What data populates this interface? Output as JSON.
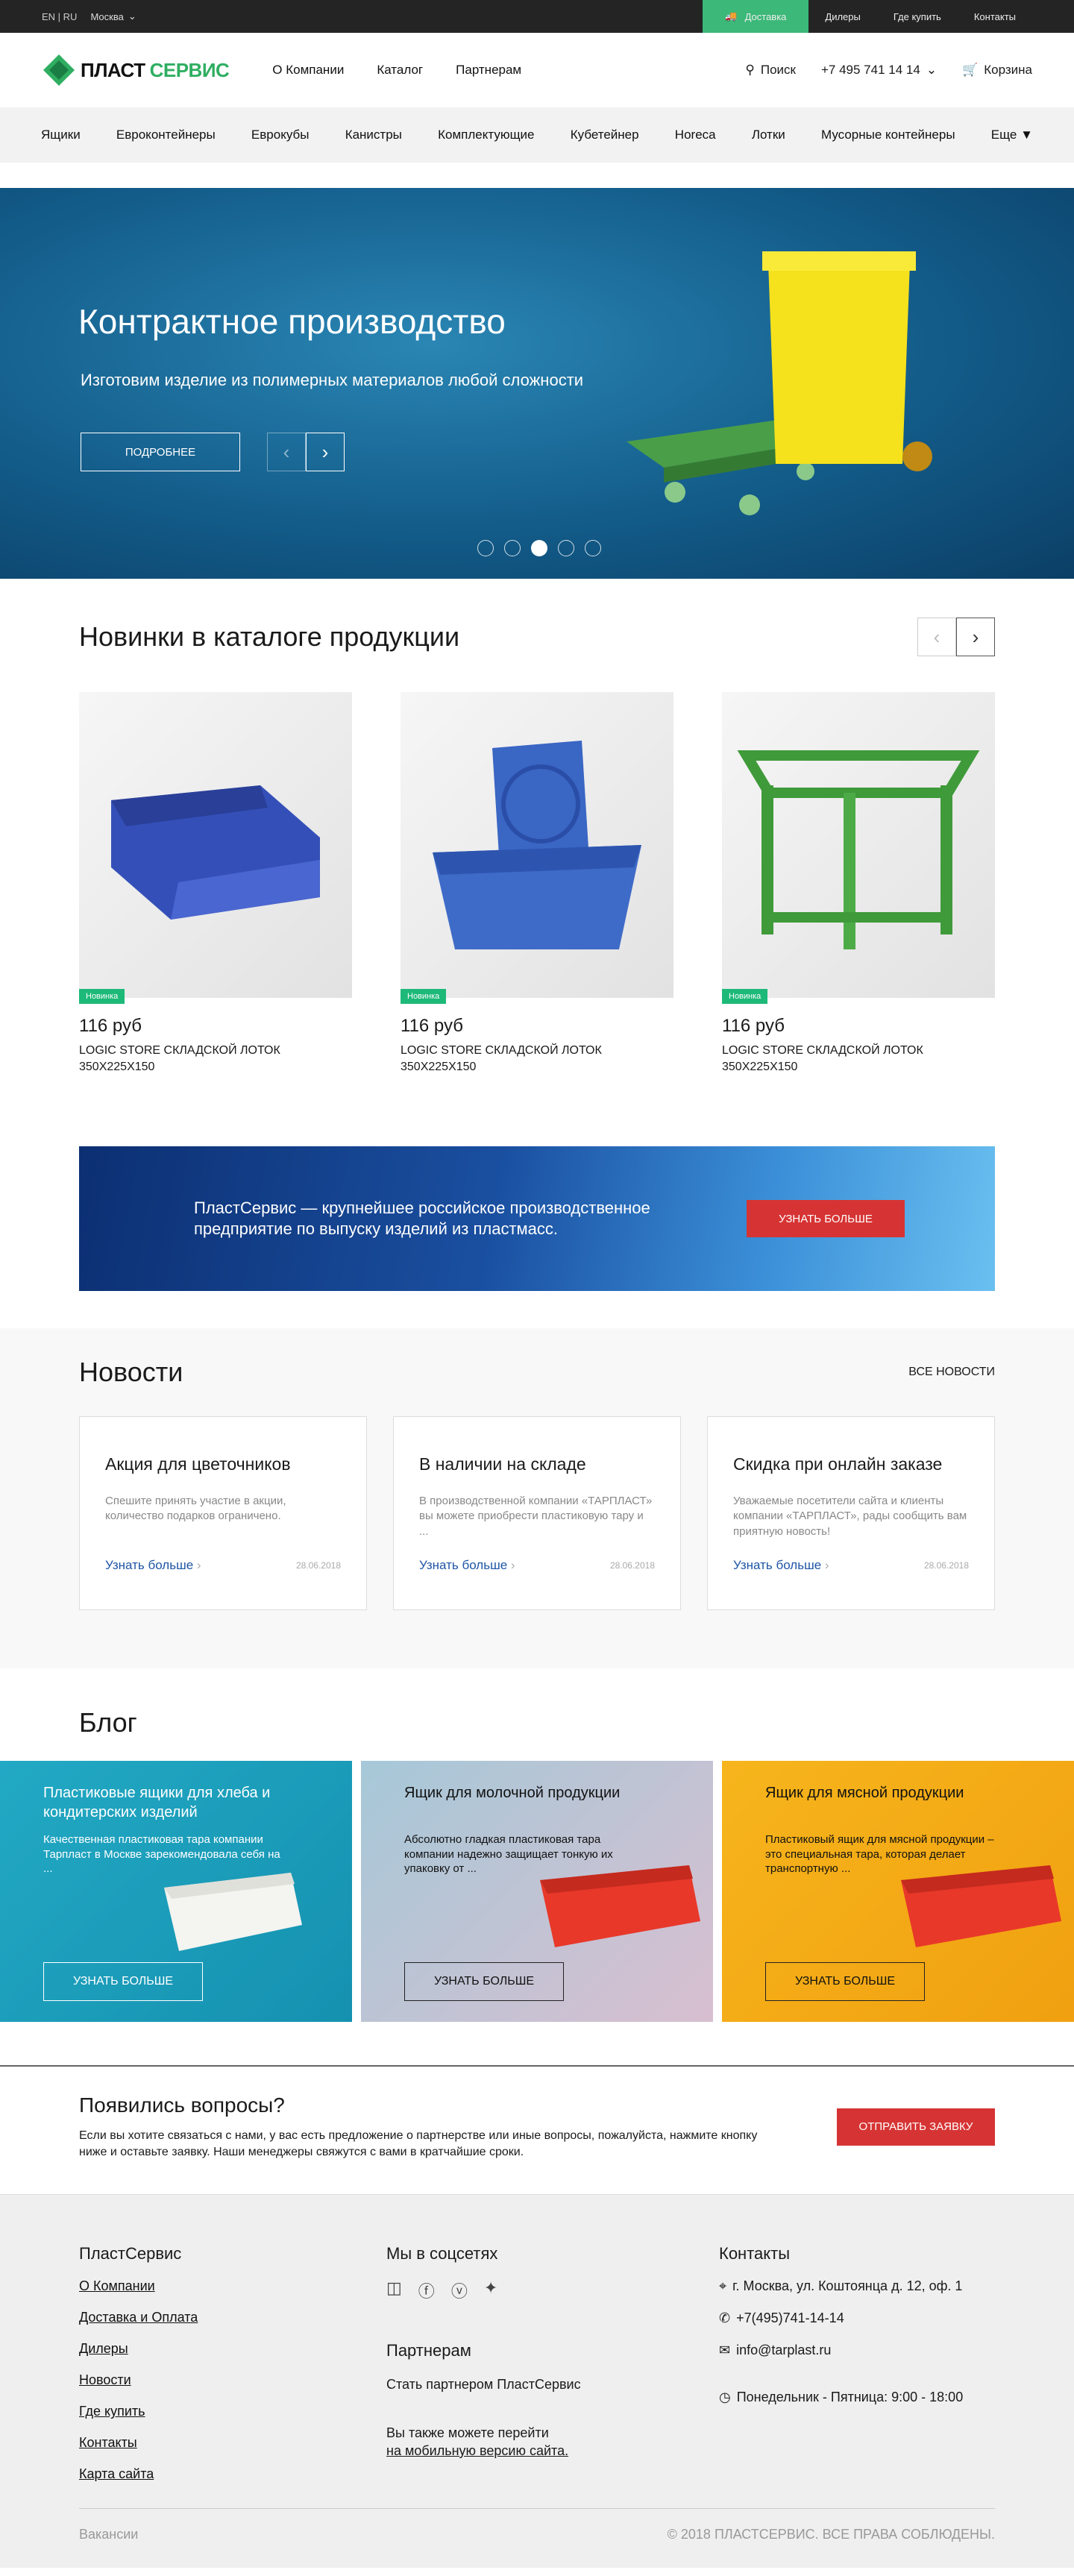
{
  "topbar": {
    "lang": "EN | RU",
    "city": "Москва",
    "delivery": "Доставка",
    "dealers": "Дилеры",
    "where_buy": "Где купить",
    "contacts": "Контакты"
  },
  "header": {
    "logo1": "ПЛАСТ",
    "logo2": "СЕРВИС",
    "nav": [
      "О Компании",
      "Каталог",
      "Партнерам"
    ],
    "search": "Поиск",
    "phone": "+7 495 741 14 14",
    "cart": "Корзина"
  },
  "catbar": [
    "Ящики",
    "Евроконтейнеры",
    "Еврокубы",
    "Канистры",
    "Комплектующие",
    "Кубетейнер",
    "Horeca",
    "Лотки",
    "Мусорные контейнеры",
    "Еще"
  ],
  "hero": {
    "title": "Контрактное производство",
    "subtitle": "Изготовим изделие из полимерных материалов любой сложности",
    "button": "ПОДРОБНЕЕ",
    "slides": 5,
    "active_slide": 3
  },
  "novelty": {
    "title": "Новинки в каталоге продукции",
    "products": [
      {
        "badge": "Новинка",
        "price": "116 руб",
        "name": "LOGIC STORE СКЛАДСКОЙ ЛОТОК 350Х225Х150",
        "color": "#3450b8"
      },
      {
        "badge": "Новинка",
        "price": "116 руб",
        "name": "LOGIC STORE СКЛАДСКОЙ ЛОТОК 350Х225Х150",
        "color": "#3a66c4"
      },
      {
        "badge": "Новинка",
        "price": "116 руб",
        "name": "LOGIC STORE СКЛАДСКОЙ ЛОТОК 350Х225Х150",
        "color": "#3f9a3a"
      }
    ]
  },
  "promo": {
    "text": "ПластСервис — крупнейшее российское производственное предприятие по выпуску изделий из пластмасс.",
    "button": "УЗНАТЬ БОЛЬШЕ"
  },
  "news": {
    "title": "Новости",
    "all": "ВСЕ НОВОСТИ",
    "items": [
      {
        "title": "Акция для цветочников",
        "text": "Спешите принять участие в акции, количество подарков ограничено.",
        "link": "Узнать больше",
        "date": "28.06.2018"
      },
      {
        "title": "В наличии на складе",
        "text": "В производственной компании «ТАРПЛАСТ» вы можете приобрести пластиковую тару и ...",
        "link": "Узнать больше",
        "date": "28.06.2018"
      },
      {
        "title": "Скидка при онлайн заказе",
        "text": "Уважаемые посетители сайта и клиенты компании «ТАРПЛАСТ», рады сообщить вам приятную новость!",
        "link": "Узнать больше",
        "date": "28.06.2018"
      }
    ]
  },
  "blog": {
    "title": "Блог",
    "items": [
      {
        "title": "Пластиковые ящики для хлеба и кондитерских изделий",
        "text": "Качественная пластиковая тара компании Тарпласт в Москве зарекомендовала себя на ...",
        "button": "УЗНАТЬ БОЛЬШЕ"
      },
      {
        "title": "Ящик для молочной продукции",
        "text": "Абсолютно гладкая пластиковая тара компании надежно защищает тонкую их упаковку от ...",
        "button": "УЗНАТЬ БОЛЬШЕ"
      },
      {
        "title": "Ящик для мясной продукции",
        "text": "Пластиковый ящик для мясной продукции – это специальная тара, которая делает транспортную ...",
        "button": "УЗНАТЬ БОЛЬШЕ"
      }
    ]
  },
  "questions": {
    "title": "Появились вопросы?",
    "text": "Если вы хотите связаться с нами, у вас есть предложение о партнерстве или иные вопросы, пожалуйста, нажмите кнопку ниже и оставьте заявку. Наши менеджеры свяжутся с вами в кратчайшие сроки.",
    "button": "ОТПРАВИТЬ ЗАЯВКУ"
  },
  "footer": {
    "col1_title": "ПластСервис",
    "links": [
      "О Компании",
      "Доставка и Оплата",
      "Дилеры",
      "Новости",
      "Где купить",
      "Контакты",
      "Карта сайта"
    ],
    "social_title": "Мы в соцсетях",
    "partners_title": "Партнерам",
    "partner_text": "Стать партнером ПластСервис",
    "mobile_text": "Вы также можете перейти",
    "mobile_link": "на мобильную версию сайта.",
    "contacts_title": "Контакты",
    "address": "г. Москва, ул. Коштоянца д. 12, оф. 1",
    "phone": "+7(495)741-14-14",
    "email": "info@tarplast.ru",
    "hours": "Понедельник - Пятница: 9:00 - 18:00",
    "vacancies": "Вакансии",
    "copyright": "© 2018 ПЛАСТСЕРВИС. ВСЕ ПРАВА СОБЛЮДЕНЫ."
  },
  "colors": {
    "green": "#3cb878",
    "red": "#d63434",
    "link": "#1e55a5"
  }
}
